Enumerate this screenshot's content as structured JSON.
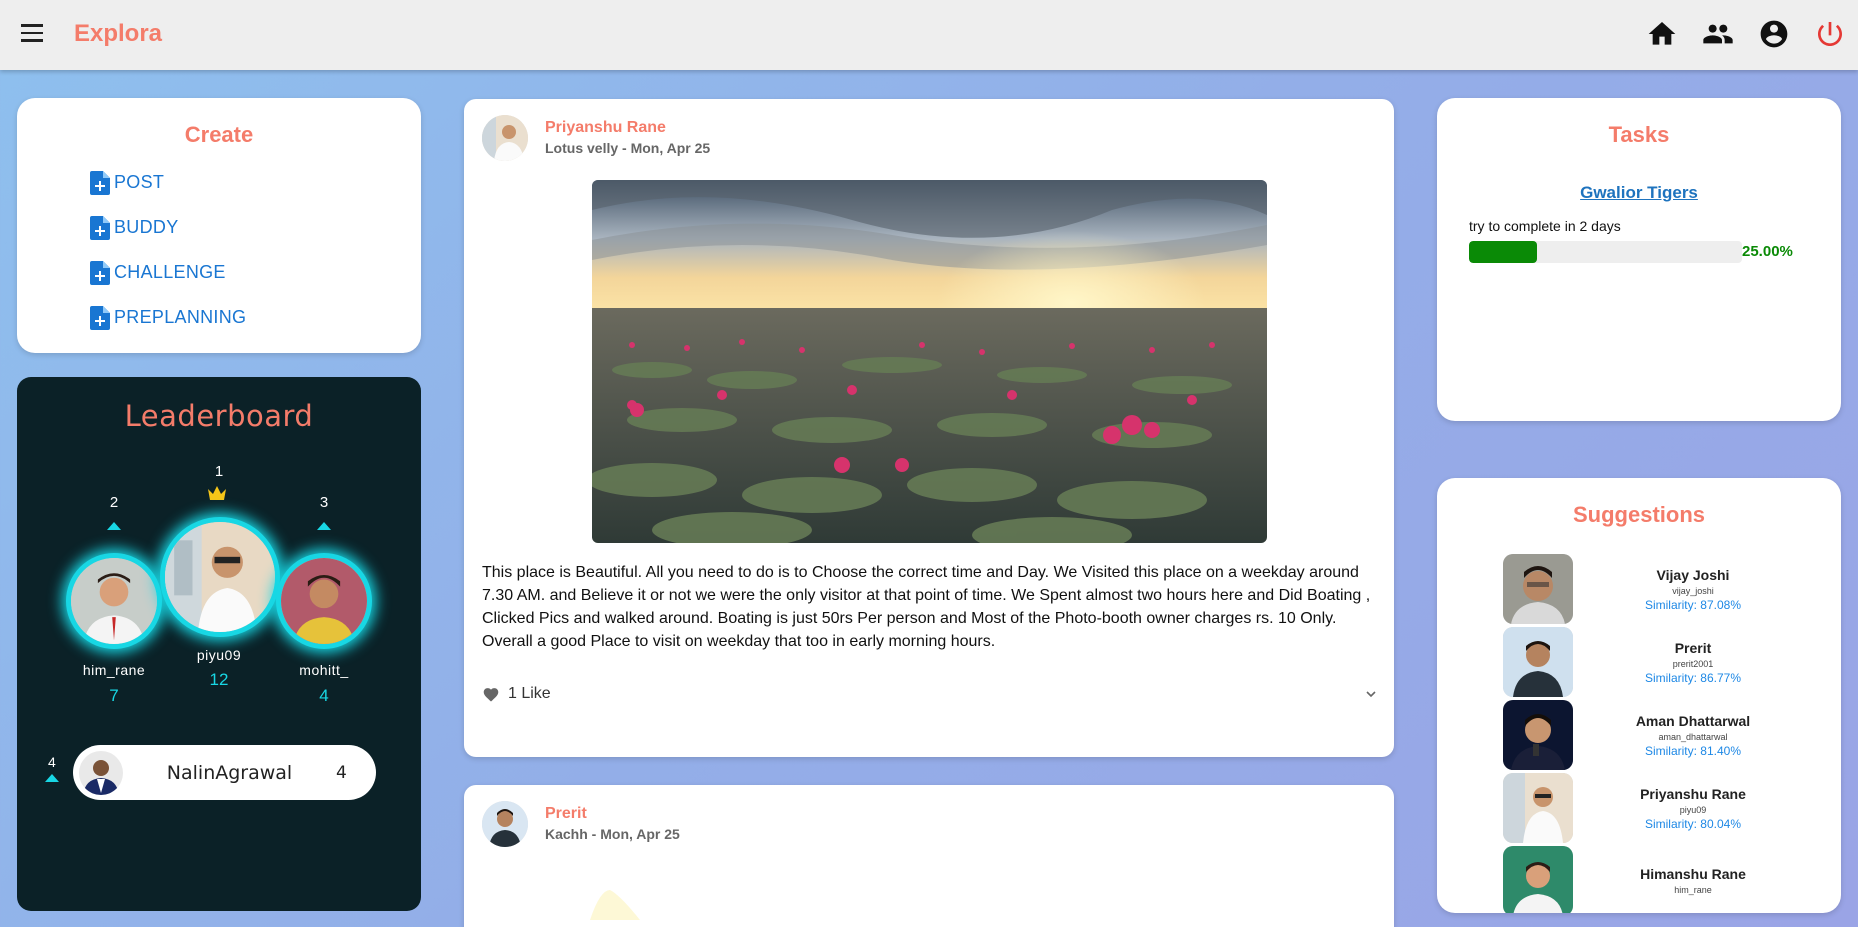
{
  "app": {
    "brand": "Explora"
  },
  "topnav": {
    "icons": [
      "home-icon",
      "people-icon",
      "account-circle-icon",
      "power-icon"
    ]
  },
  "create": {
    "title": "Create",
    "items": [
      {
        "label": "POST"
      },
      {
        "label": "BUDDY"
      },
      {
        "label": "CHALLENGE"
      },
      {
        "label": "PREPLANNING"
      }
    ]
  },
  "leaderboard": {
    "title": "Leaderboard",
    "podium": [
      {
        "rank": "2",
        "name": "him_rane",
        "score": "7"
      },
      {
        "rank": "1",
        "name": "piyu09",
        "score": "12"
      },
      {
        "rank": "3",
        "name": "mohitt_",
        "score": "4"
      }
    ],
    "rest": [
      {
        "rank": "4",
        "name": "NalinAgrawal",
        "score": "4"
      }
    ]
  },
  "posts": [
    {
      "author": "Priyanshu Rane",
      "subtitle": "Lotus velly - Mon, Apr 25",
      "text": "This place is Beautiful. All you need to do is to Choose the correct time and Day. We Visited this place on a weekday around 7.30 AM. and Believe it or not we were the only visitor at that point of time. We Spent almost two hours here and Did Boating , Clicked Pics and walked around. Boating is just 50rs Per person and Most of the Photo-booth owner charges rs. 10 Only. Overall a good Place to visit on weekday that too in early morning hours.",
      "likes": "1 Like"
    },
    {
      "author": "Prerit",
      "subtitle": "Kachh - Mon, Apr 25"
    }
  ],
  "tasks": {
    "title": "Tasks",
    "items": [
      {
        "name": "Gwalior Tigers",
        "desc": "try to complete in 2 days",
        "progress": 0.25,
        "progress_label": "25.00%"
      }
    ]
  },
  "suggestions": {
    "title": "Suggestions",
    "items": [
      {
        "name": "Vijay Joshi",
        "username": "vijay_joshi",
        "similarity": "Similarity: 87.08%"
      },
      {
        "name": "Prerit",
        "username": "prerit2001",
        "similarity": "Similarity: 86.77%"
      },
      {
        "name": "Aman Dhattarwal",
        "username": "aman_dhattarwal",
        "similarity": "Similarity: 81.40%"
      },
      {
        "name": "Priyanshu Rane",
        "username": "piyu09",
        "similarity": "Similarity: 80.04%"
      },
      {
        "name": "Himanshu Rane",
        "username": "him_rane",
        "similarity": ""
      }
    ]
  },
  "colors": {
    "accent": "#f47c6a",
    "link": "#1976d2",
    "cyan": "#18d7e4",
    "progress": "#0a8a06",
    "logout": "#e53935"
  }
}
